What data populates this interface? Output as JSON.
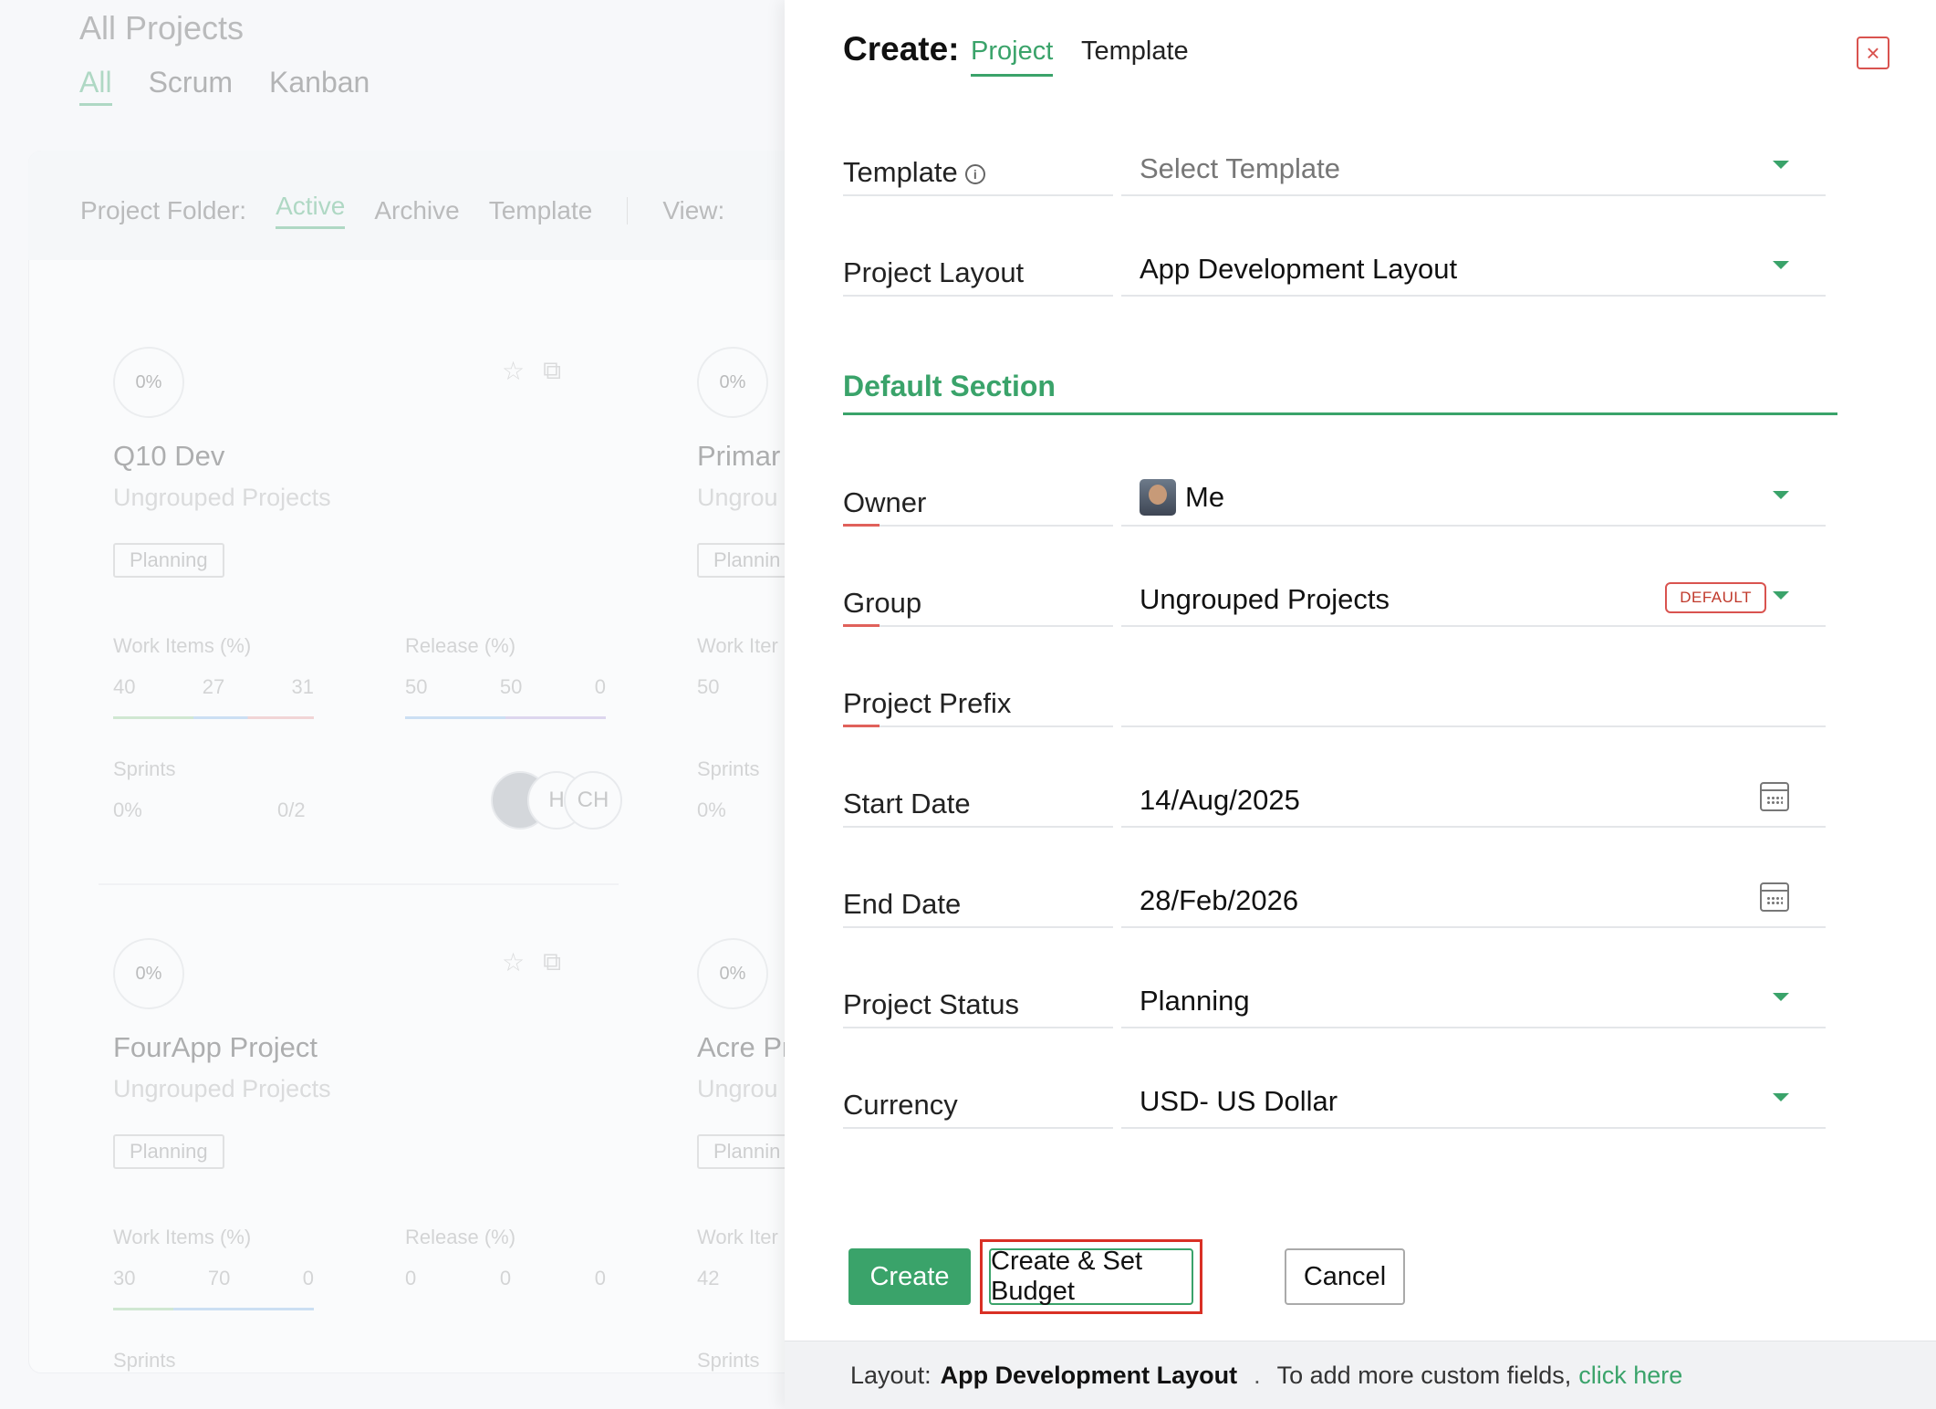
{
  "background": {
    "page_title": "All Projects",
    "view_tabs": [
      "All",
      "Scrum",
      "Kanban"
    ],
    "folder_label": "Project Folder:",
    "folder_tabs": [
      "Active",
      "Archive",
      "Template"
    ],
    "view_label": "View:",
    "cards": [
      {
        "percent": "0%",
        "title": "Q10 Dev",
        "group": "Ungrouped Projects",
        "status": "Planning",
        "work_items_label": "Work Items (%)",
        "work_items": [
          "40",
          "27",
          "31"
        ],
        "release_label": "Release (%)",
        "release": [
          "50",
          "50",
          "0"
        ],
        "sprints_label": "Sprints",
        "sprints_pct": "0%",
        "sprints_count": "0/2",
        "avatars": [
          "H",
          "CH"
        ]
      },
      {
        "percent": "0%",
        "title": "Primar",
        "group": "Ungrou",
        "status": "Plannin",
        "work_items_label": "Work Iter",
        "work_items": [
          "50"
        ],
        "sprints_label": "Sprints",
        "sprints_pct": "0%"
      },
      {
        "percent": "0%",
        "title": "FourApp Project",
        "group": "Ungrouped Projects",
        "status": "Planning",
        "work_items_label": "Work Items (%)",
        "work_items": [
          "30",
          "70",
          "0"
        ],
        "release_label": "Release (%)",
        "release": [
          "0",
          "0",
          "0"
        ],
        "sprints_label": "Sprints"
      },
      {
        "percent": "0%",
        "title": "Acre Pr",
        "group": "Ungrou",
        "status": "Plannin",
        "work_items_label": "Work Iter",
        "work_items": [
          "42"
        ],
        "sprints_label": "Sprints"
      }
    ]
  },
  "drawer": {
    "title": "Create:",
    "tabs": [
      "Project",
      "Template"
    ],
    "active_tab": "Project",
    "close_icon": "close-icon",
    "template": {
      "label": "Template",
      "placeholder": "Select Template"
    },
    "layout": {
      "label": "Project Layout",
      "value": "App Development Layout"
    },
    "section_title": "Default Section",
    "owner": {
      "label": "Owner",
      "value": "Me"
    },
    "group": {
      "label": "Group",
      "value": "Ungrouped Projects",
      "badge": "DEFAULT"
    },
    "prefix": {
      "label": "Project Prefix",
      "value": ""
    },
    "start_date": {
      "label": "Start Date",
      "value": "14/Aug/2025"
    },
    "end_date": {
      "label": "End Date",
      "value": "28/Feb/2026"
    },
    "status": {
      "label": "Project Status",
      "value": "Planning"
    },
    "currency": {
      "label": "Currency",
      "value": "USD- US Dollar"
    },
    "buttons": {
      "create": "Create",
      "create_budget": "Create & Set Budget",
      "cancel": "Cancel"
    },
    "footer": {
      "layout_label": "Layout:",
      "layout_value": "App Development Layout",
      "dot": ".",
      "text": "To add more custom fields,",
      "link": "click here"
    }
  },
  "colors": {
    "accent": "#3aa36a",
    "required": "#e0615b",
    "highlight": "#d93025"
  }
}
